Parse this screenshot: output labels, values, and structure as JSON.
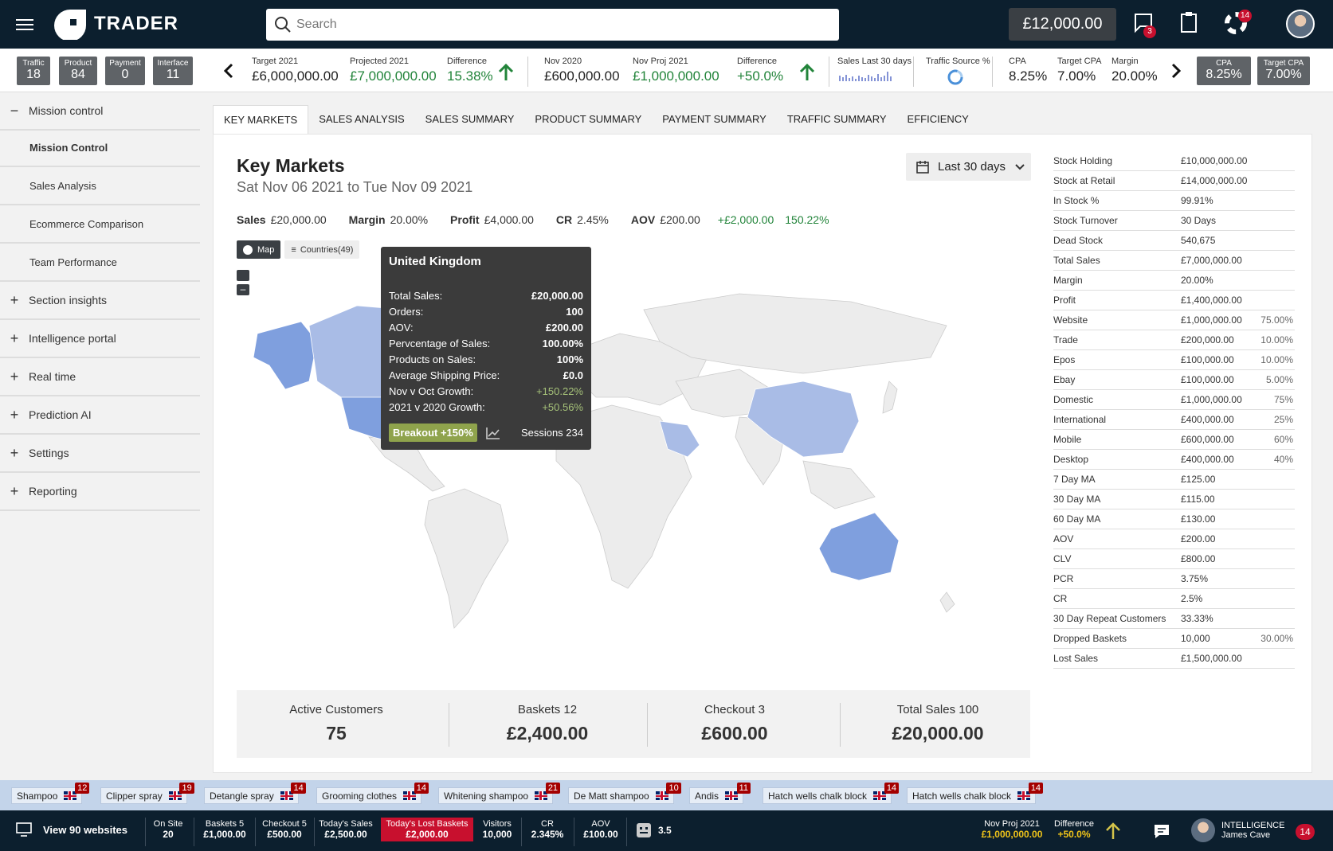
{
  "app": {
    "logo_text": "TRADER",
    "search_placeholder": "Search",
    "balance": "£12,000.00",
    "chat_badge": "3",
    "alerts_badge": "14"
  },
  "chips": [
    {
      "label": "Traffic",
      "value": "18"
    },
    {
      "label": "Product",
      "value": "84"
    },
    {
      "label": "Payment",
      "value": "0"
    },
    {
      "label": "Interface",
      "value": "11"
    }
  ],
  "kpis": {
    "target2021": {
      "label": "Target 2021",
      "value": "£6,000,000.00"
    },
    "proj2021": {
      "label": "Projected 2021",
      "value": "£7,000,000.00"
    },
    "diff1": {
      "label": "Difference",
      "value": "15.38%"
    },
    "nov2020": {
      "label": "Nov 2020",
      "value": "£600,000.00"
    },
    "novproj": {
      "label": "Nov Proj 2021",
      "value": "£1,000,000.00"
    },
    "diff2": {
      "label": "Difference",
      "value": "+50.0%"
    },
    "sales30": {
      "label": "Sales Last 30 days"
    },
    "traffic": {
      "label": "Traffic Source %"
    },
    "cpa": {
      "label": "CPA",
      "value": "8.25%"
    },
    "tcpa": {
      "label": "Target CPA",
      "value": "7.00%"
    },
    "margin": {
      "label": "Margin",
      "value": "20.00%"
    },
    "chip_cpa": {
      "label": "CPA",
      "value": "8.25%"
    },
    "chip_tcpa": {
      "label": "Target CPA",
      "value": "7.00%"
    }
  },
  "sidebar": {
    "mission": "Mission control",
    "subs": [
      "Mission Control",
      "Sales Analysis",
      "Ecommerce Comparison",
      "Team Performance"
    ],
    "items": [
      "Section insights",
      "Intelligence portal",
      "Real time",
      "Prediction AI",
      "Settings",
      "Reporting"
    ]
  },
  "tabs": [
    "KEY MARKETS",
    "SALES ANALYSIS",
    "SALES SUMMARY",
    "PRODUCT SUMMARY",
    "PAYMENT SUMMARY",
    "TRAFFIC SUMMARY",
    "EFFICIENCY"
  ],
  "main": {
    "title": "Key Markets",
    "date_range": "Sat Nov 06 2021 to Tue Nov 09 2021",
    "date_button": "Last 30 days",
    "metrics": {
      "sales_l": "Sales",
      "sales_v": "£20,000.00",
      "margin_l": "Margin",
      "margin_v": "20.00%",
      "profit_l": "Profit",
      "profit_v": "£4,000.00",
      "cr_l": "CR",
      "cr_v": "2.45%",
      "aov_l": "AOV",
      "aov_v": "£200.00",
      "delta": "+£2,000.00",
      "delta_pct": "150.22%"
    },
    "toggle_map": "Map",
    "toggle_countries": "Countries(49)"
  },
  "tooltip": {
    "country": "United Kingdom",
    "rows": [
      [
        "Total Sales:",
        "£20,000.00"
      ],
      [
        "Orders:",
        "100"
      ],
      [
        "AOV:",
        "£200.00"
      ],
      [
        "Pervcentage of Sales:",
        "100.00%"
      ],
      [
        "Products on Sales:",
        "100%"
      ],
      [
        "Average Shipping Price:",
        "£0.0"
      ],
      [
        "Nov v Oct Growth:",
        "+150.22%"
      ],
      [
        "2021 v 2020 Growth:",
        "+50.56%"
      ]
    ],
    "breakout": "Breakout +150%",
    "sessions": "Sessions 234"
  },
  "summary": {
    "active_l": "Active Customers",
    "active_v": "75",
    "baskets_l": "Baskets 12",
    "baskets_v": "£2,400.00",
    "checkout_l": "Checkout 3",
    "checkout_v": "£600.00",
    "total_l": "Total Sales  100",
    "total_v": "£20,000.00"
  },
  "stats": [
    [
      "Stock Holding",
      "£10,000,000.00",
      ""
    ],
    [
      "Stock at Retail",
      "£14,000,000.00",
      ""
    ],
    [
      "In Stock %",
      "99.91%",
      ""
    ],
    [
      "Stock Turnover",
      "30 Days",
      ""
    ],
    [
      "Dead Stock",
      "540,675",
      ""
    ],
    [
      "Total Sales",
      "£7,000,000.00",
      ""
    ],
    [
      "Margin",
      "20.00%",
      ""
    ],
    [
      "Profit",
      "£1,400,000.00",
      ""
    ],
    [
      "Website",
      "£1,000,000.00",
      "75.00%"
    ],
    [
      "Trade",
      "£200,000.00",
      "10.00%"
    ],
    [
      "Epos",
      "£100,000.00",
      "10.00%"
    ],
    [
      "Ebay",
      "£100,000.00",
      "5.00%"
    ],
    [
      "Domestic",
      "£1,000,000.00",
      "75%"
    ],
    [
      "International",
      "£400,000.00",
      "25%"
    ],
    [
      "Mobile",
      "£600,000.00",
      "60%"
    ],
    [
      "Desktop",
      "£400,000.00",
      "40%"
    ],
    [
      "7 Day MA",
      "£125.00",
      ""
    ],
    [
      "30 Day MA",
      "£115.00",
      ""
    ],
    [
      "60 Day MA",
      "£130.00",
      ""
    ],
    [
      "AOV",
      "£200.00",
      ""
    ],
    [
      "CLV",
      "£800.00",
      ""
    ],
    [
      "PCR",
      "3.75%",
      ""
    ],
    [
      "CR",
      "2.5%",
      ""
    ],
    [
      "30 Day Repeat Customers",
      "33.33%",
      ""
    ],
    [
      "Dropped Baskets",
      "10,000",
      "30.00%"
    ],
    [
      "Lost Sales",
      "£1,500,000.00",
      ""
    ]
  ],
  "tags": [
    [
      "Shampoo",
      "12"
    ],
    [
      "Clipper spray",
      "19"
    ],
    [
      "Detangle spray",
      "14"
    ],
    [
      "Grooming clothes",
      "14"
    ],
    [
      "Whitening shampoo",
      "21"
    ],
    [
      "De Matt shampoo",
      "10"
    ],
    [
      "Andis",
      "11"
    ],
    [
      "Hatch wells chalk block",
      "14"
    ],
    [
      "Hatch wells chalk block",
      "14"
    ]
  ],
  "footer": {
    "websites": "View 90 websites",
    "onsite_l": "On Site",
    "onsite_v": "20",
    "baskets_l": "Baskets 5",
    "baskets_v": "£1,000.00",
    "checkout_l": "Checkout 5",
    "checkout_v": "£500.00",
    "today_l": "Today's Sales",
    "today_v": "£2,500.00",
    "lost_l": "Today's Lost Baskets",
    "lost_v": "£2,000.00",
    "visitors_l": "Visitors",
    "visitors_v": "10,000",
    "cr_l": "CR",
    "cr_v": "2.345%",
    "aov_l": "AOV",
    "aov_v": "£100.00",
    "rating": "3.5",
    "proj_l": "Nov Proj 2021",
    "proj_v": "£1,000,000.00",
    "diff_l": "Difference",
    "diff_v": "+50.0%",
    "user_title": "INTELLIGENCE",
    "user_name": "James Cave",
    "notif": "14"
  },
  "colors": {
    "navy": "#0c1f2e",
    "green": "#22843a",
    "map_light": "#a9bce6",
    "map_mid": "#7f9fde",
    "map_uk": "#2d3a8c"
  }
}
